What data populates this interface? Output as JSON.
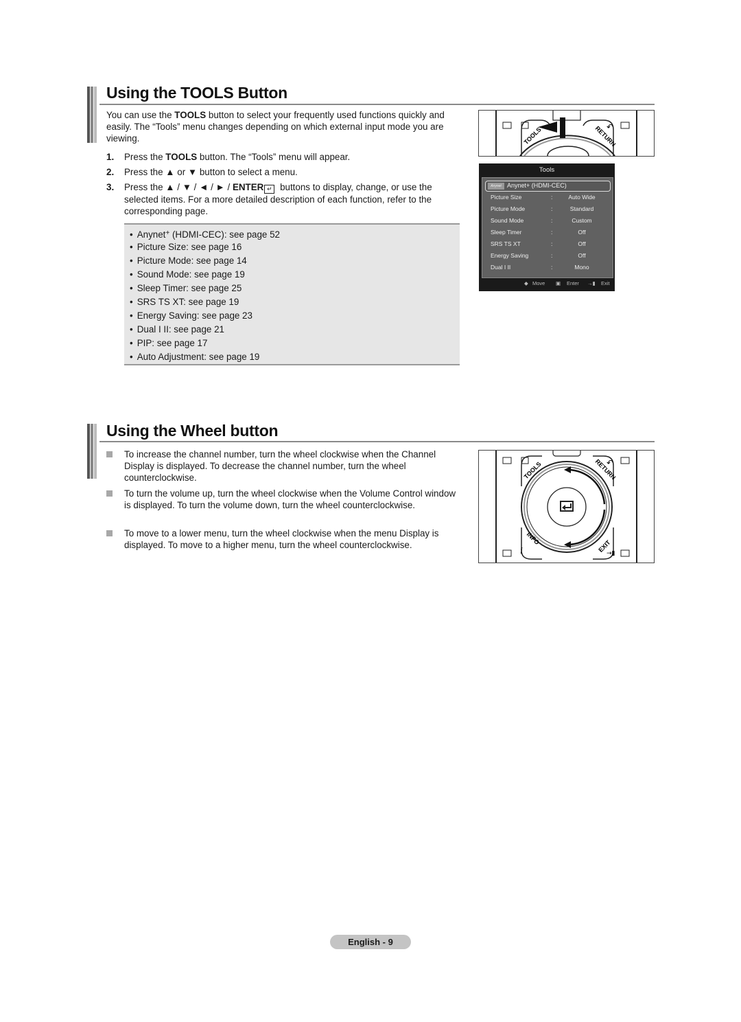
{
  "section1": {
    "title": "Using the TOOLS Button",
    "intro_pre": "You can use the ",
    "intro_bold": "TOOLS",
    "intro_post": " button to select your frequently used functions quickly and easily. The “Tools” menu changes depending on which external input mode you are viewing.",
    "steps": [
      {
        "num": "1.",
        "pre": "Press the ",
        "bold": "TOOLS",
        "post": " button. The “Tools” menu will appear."
      },
      {
        "num": "2.",
        "text": "Press the ▲ or ▼ button to select a menu."
      },
      {
        "num": "3.",
        "pre": "Press the ▲ / ▼ / ◄ / ► / ",
        "bold": "ENTER",
        "post": " buttons to display, change, or use the selected items. For a more detailed description of each function, refer to the corresponding page."
      }
    ],
    "bullets": [
      {
        "pre": "Anynet",
        "sup": "+",
        "post": " (HDMI-CEC): see page 52"
      },
      {
        "text": "Picture Size: see page 16"
      },
      {
        "text": "Picture Mode: see page 14"
      },
      {
        "text": "Sound Mode: see page 19"
      },
      {
        "text": "Sleep Timer: see page 25"
      },
      {
        "text": "SRS TS XT: see page 19"
      },
      {
        "text": "Energy Saving: see page 23"
      },
      {
        "text": "Dual I II: see page 21"
      },
      {
        "text": "PIP: see page 17"
      },
      {
        "text": "Auto Adjustment: see page 19"
      }
    ]
  },
  "tools_menu": {
    "title": "Tools",
    "selected_logo": "Anynet",
    "selected_label": "Anynet+ (HDMI-CEC)",
    "rows": [
      {
        "key": "Picture Size",
        "sep": ":",
        "value": "Auto Wide"
      },
      {
        "key": "Picture Mode",
        "sep": ":",
        "value": "Standard"
      },
      {
        "key": "Sound Mode",
        "sep": ":",
        "value": "Custom"
      },
      {
        "key": "Sleep Timer",
        "sep": ":",
        "value": "Off"
      },
      {
        "key": "SRS TS XT",
        "sep": ":",
        "value": "Off"
      },
      {
        "key": "Energy Saving",
        "sep": ":",
        "value": "Off"
      },
      {
        "key": "Dual I II",
        "sep": ":",
        "value": "Mono"
      }
    ],
    "footer": {
      "move": "Move",
      "enter": "Enter",
      "exit": "Exit"
    }
  },
  "remote_labels": {
    "tools": "TOOLS",
    "return": "RETURN",
    "info": "INFO",
    "exit": "EXIT",
    "info_glyph": "i"
  },
  "section2": {
    "title": "Using the Wheel button",
    "items": [
      "To increase the channel number, turn the wheel clockwise when the Channel Display is displayed. To decrease the channel number, turn the wheel counterclockwise.",
      "To turn the volume up, turn the wheel clockwise when the Volume Control window is displayed. To turn the volume down, turn the wheel counterclockwise.",
      "To move to a lower menu, turn the wheel clockwise when the menu Display is displayed. To move to a higher menu, turn the wheel counterclockwise."
    ]
  },
  "footer": {
    "page_label": "English - 9"
  }
}
